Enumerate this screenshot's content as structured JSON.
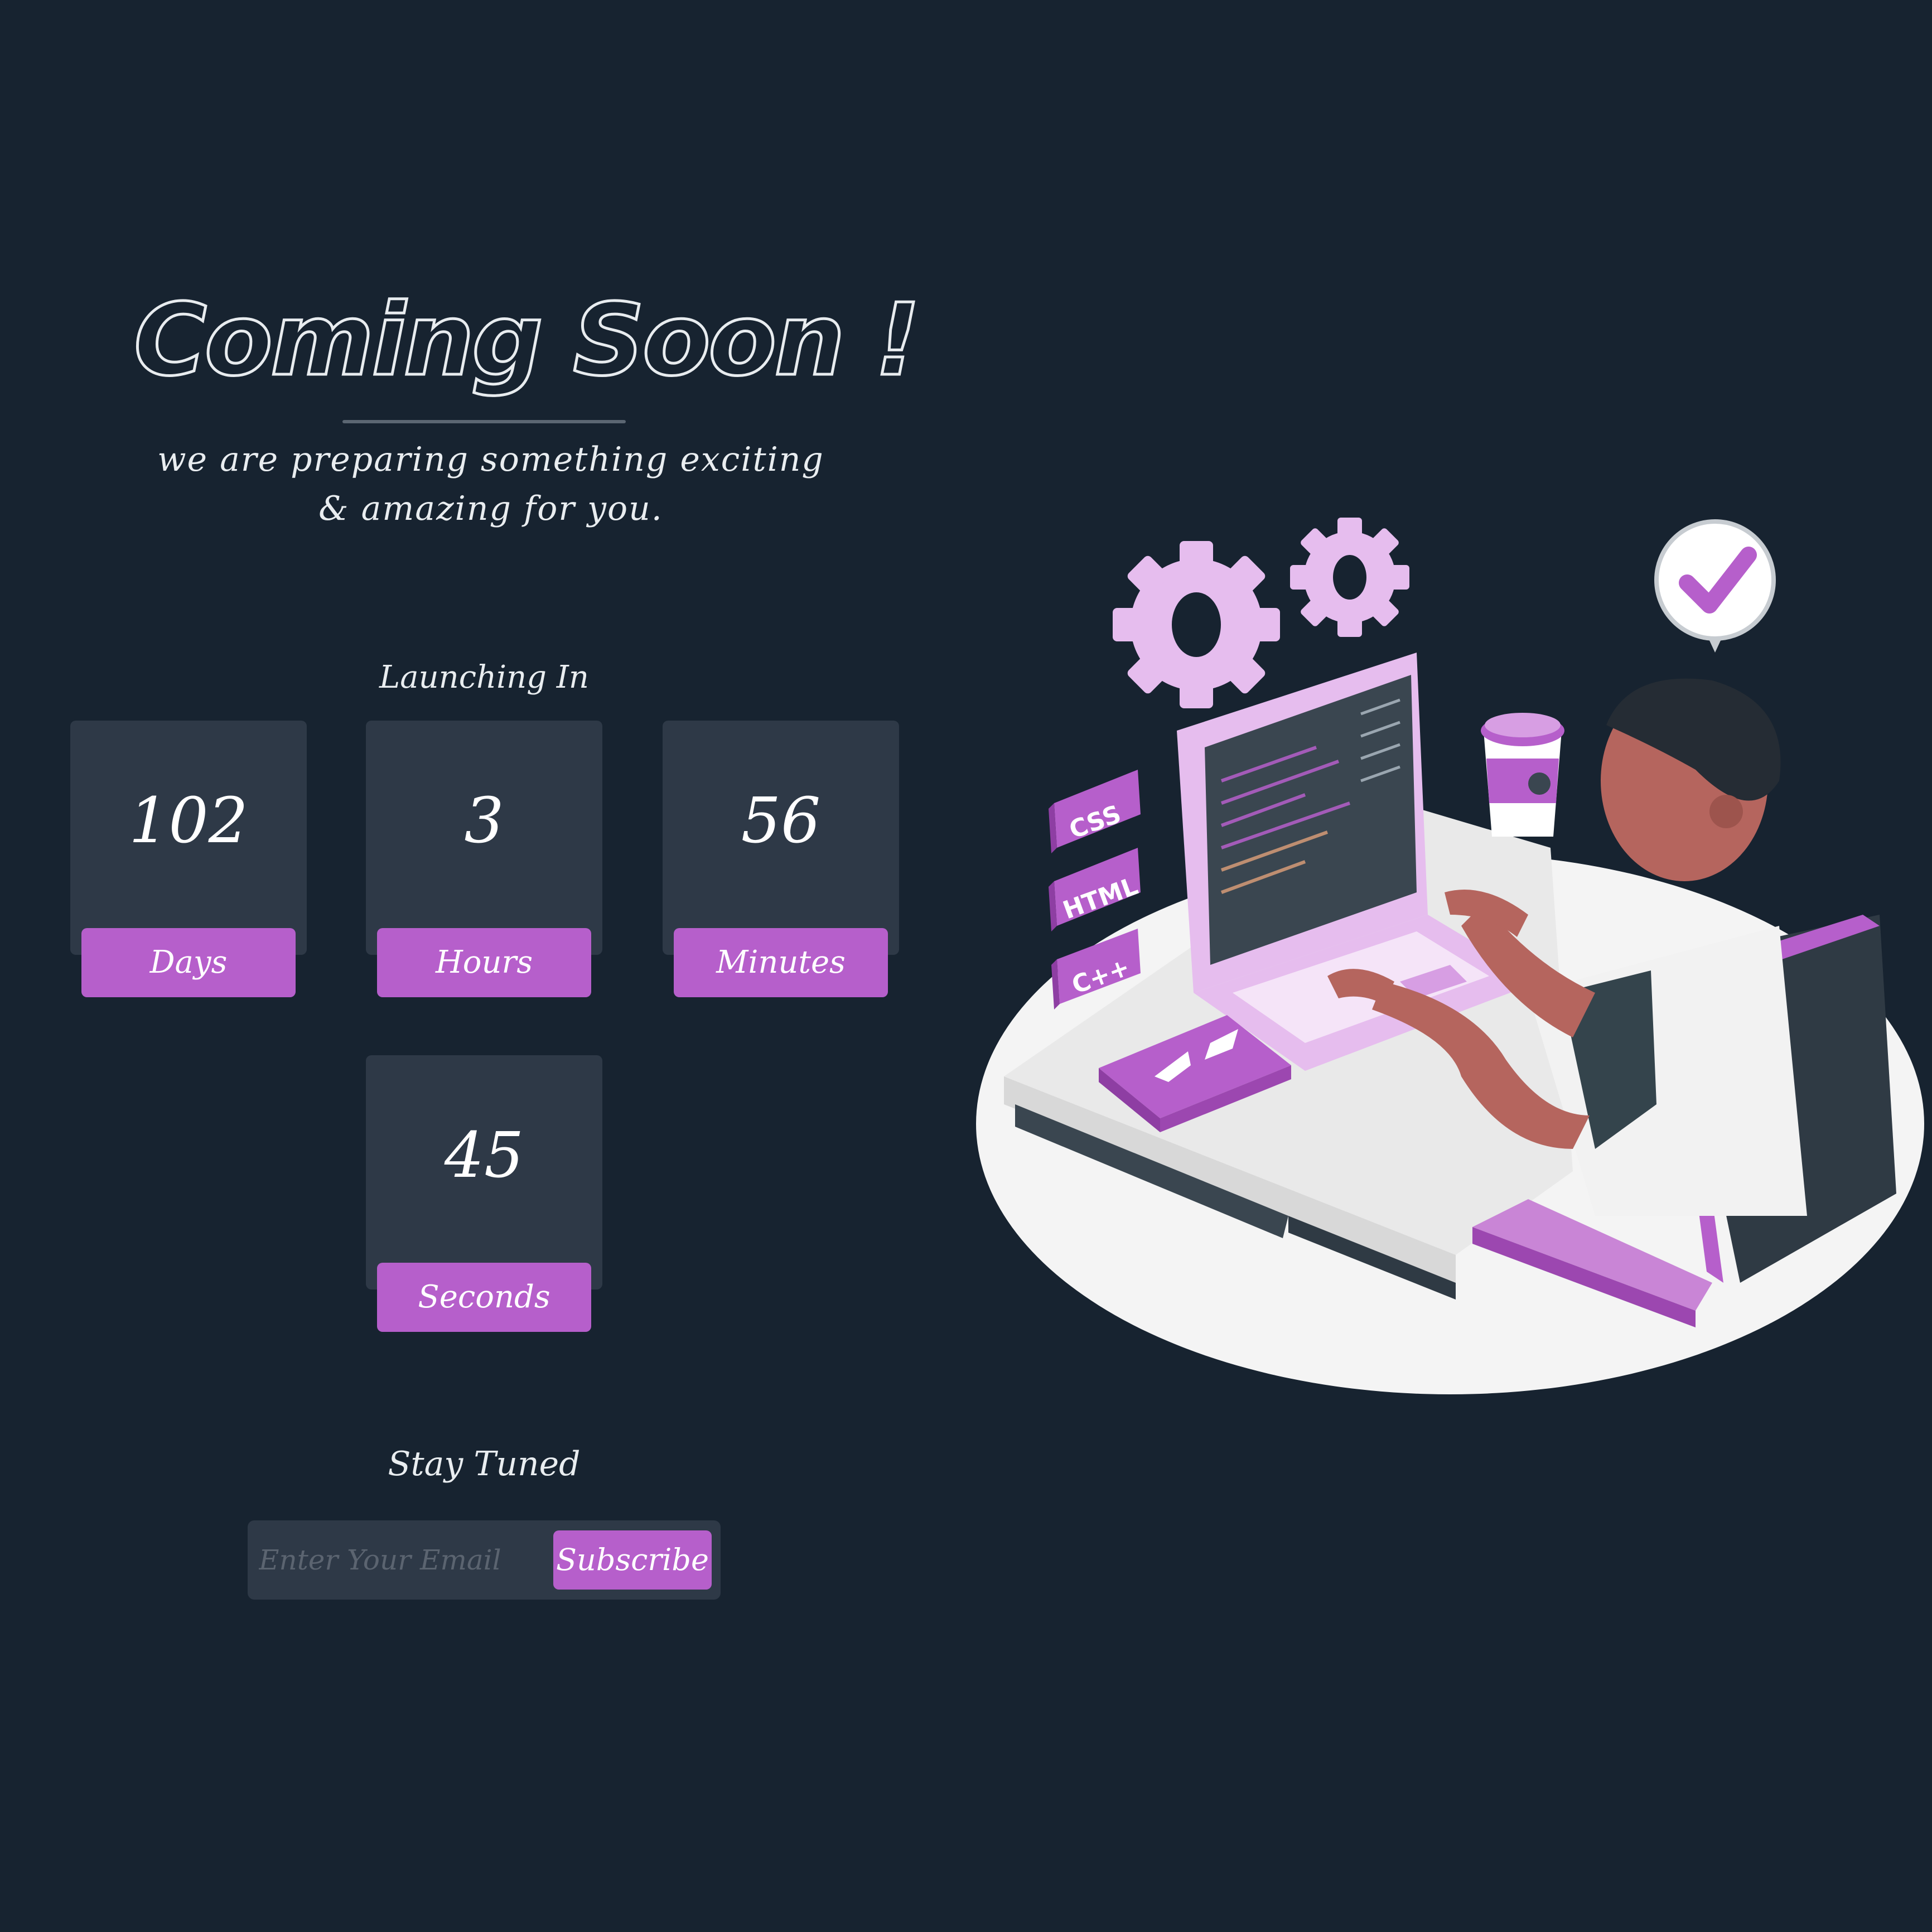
{
  "header": {
    "title": "Coming Soon !",
    "subtitle": "we are preparing something exciting & amazing for you."
  },
  "countdown": {
    "label": "Launching In",
    "units": [
      {
        "value": "102",
        "label": "Days"
      },
      {
        "value": "3",
        "label": "Hours"
      },
      {
        "value": "56",
        "label": "Minutes"
      },
      {
        "value": "45",
        "label": "Seconds"
      }
    ]
  },
  "newsletter": {
    "label": "Stay Tuned",
    "email_placeholder": "Enter Your Email",
    "button_label": "Subscribe"
  },
  "illustration": {
    "tags": [
      "CSS",
      "HTML",
      "C++"
    ]
  },
  "colors": {
    "background": "#172330",
    "card": "#2e3947",
    "accent": "#b65fcb",
    "text": "#ffffff"
  }
}
